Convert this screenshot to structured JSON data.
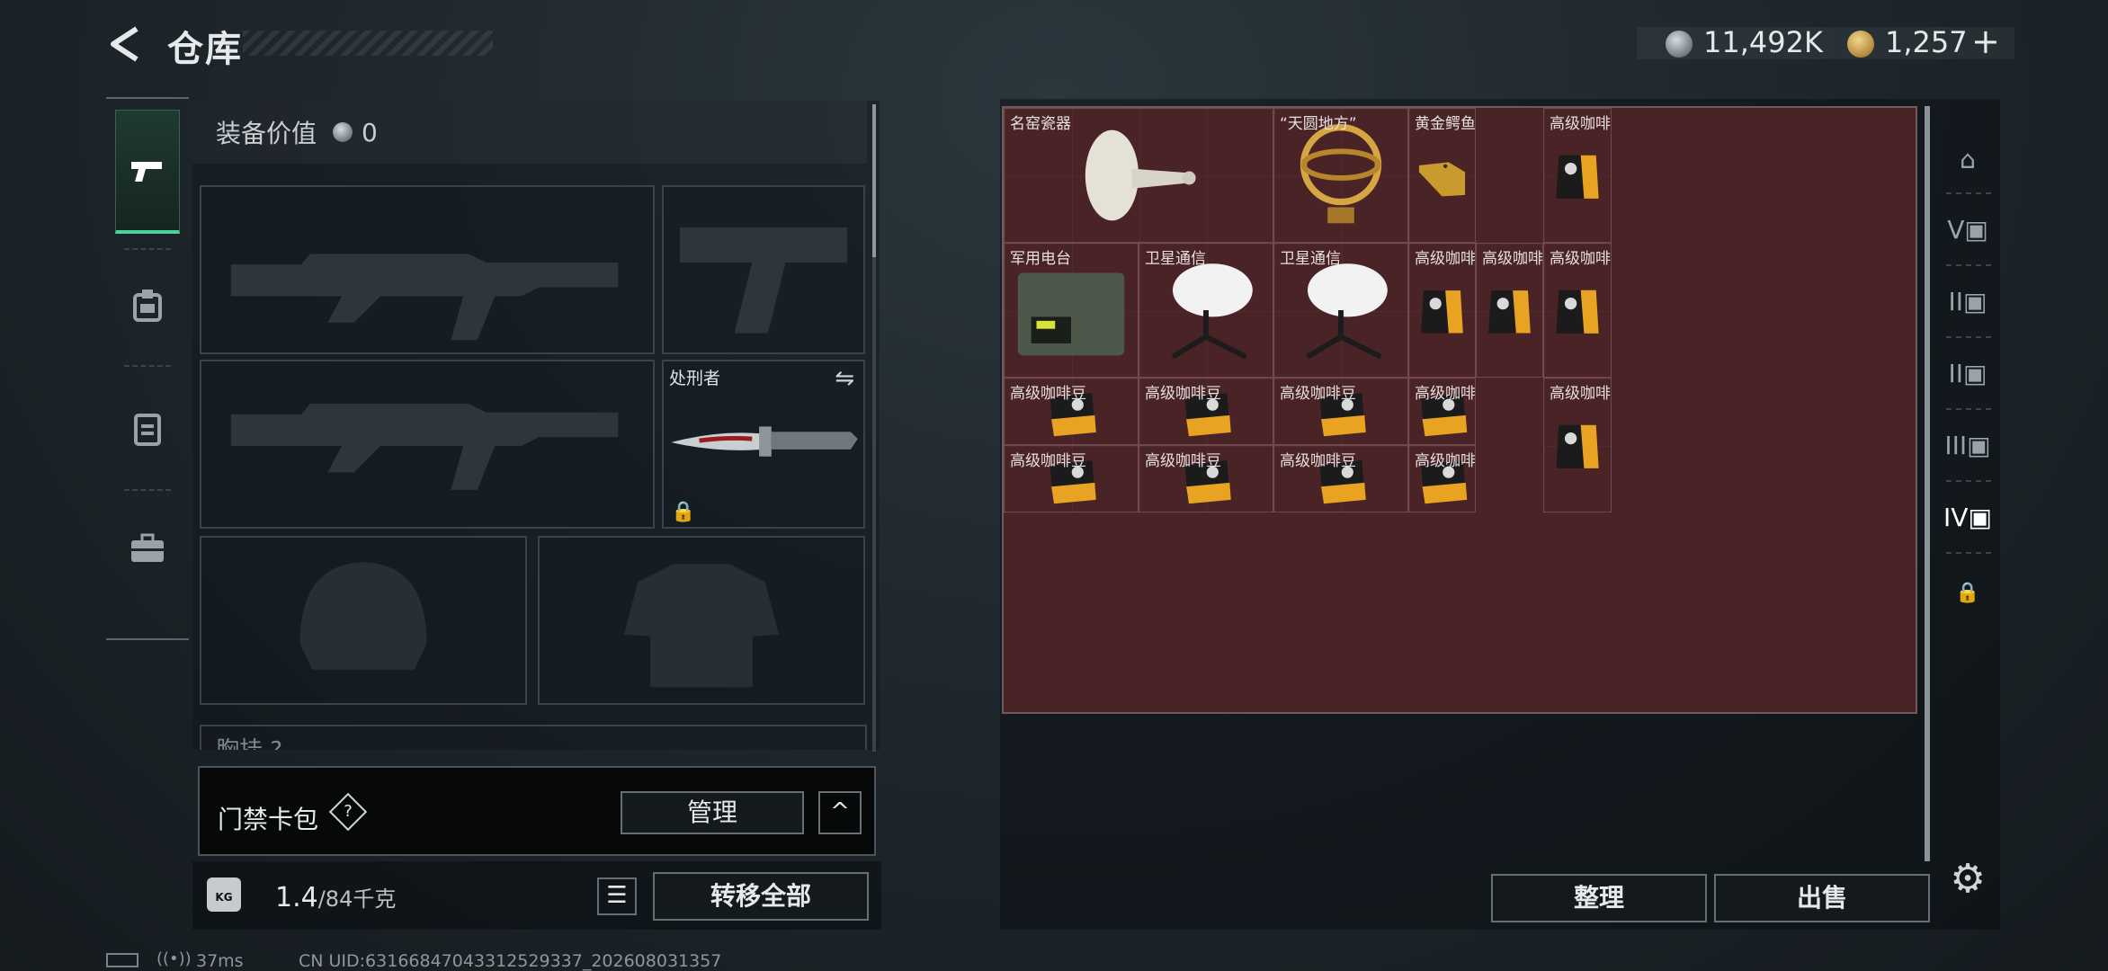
{
  "header": {
    "title": "仓库",
    "currency_silver": "11,492K",
    "currency_gold": "1,257",
    "currency_add": "+"
  },
  "tabs": [
    {
      "icon": "pistol-icon",
      "active": true
    },
    {
      "icon": "armor-rig-icon",
      "active": false
    },
    {
      "icon": "backpack-icon",
      "active": false
    },
    {
      "icon": "toolbox-icon",
      "active": false
    }
  ],
  "equipment": {
    "value_label": "装备价值",
    "value": "0",
    "knife_name": "处刑者",
    "chest_label": "胸挂 ?"
  },
  "card_wallet": {
    "label": "门禁卡包",
    "help": "?",
    "manage": "管理",
    "collapse": "^"
  },
  "weight": {
    "current": "1.4",
    "max": "/84千克",
    "kg_icon": "KG",
    "transfer_all": "转移全部"
  },
  "stash": {
    "items": [
      {
        "name": "名窑瓷器",
        "kind": "vase"
      },
      {
        "name": "“天圆地方”",
        "kind": "armillary"
      },
      {
        "name": "黄金鳄鱼头",
        "kind": "croc"
      },
      {
        "name": "高级咖啡豆",
        "kind": "bag"
      },
      {
        "name": "军用电台",
        "kind": "radio"
      },
      {
        "name": "卫星通信",
        "kind": "dish"
      },
      {
        "name": "卫星通信",
        "kind": "dish"
      },
      {
        "name": "高级咖啡豆",
        "kind": "bag"
      },
      {
        "name": "高级咖啡豆",
        "kind": "bag"
      },
      {
        "name": "高级咖啡豆",
        "kind": "bag"
      },
      {
        "name": "高级咖啡豆",
        "kind": "box"
      },
      {
        "name": "高级咖啡豆",
        "kind": "box"
      },
      {
        "name": "高级咖啡豆",
        "kind": "box"
      },
      {
        "name": "高级咖啡豆",
        "kind": "box"
      },
      {
        "name": "高级咖啡豆",
        "kind": "bag"
      },
      {
        "name": "高级咖啡豆",
        "kind": "box"
      },
      {
        "name": "高级咖啡豆",
        "kind": "box"
      },
      {
        "name": "高级咖啡豆",
        "kind": "box"
      },
      {
        "name": "高级咖啡豆",
        "kind": "box"
      }
    ],
    "sort_button": "整理",
    "sell_button": "出售"
  },
  "right_tabs": [
    {
      "icon": "safe-box-icon"
    },
    {
      "label": "V",
      "icon": "stash-page-icon"
    },
    {
      "label": "II",
      "icon": "stash-page-icon"
    },
    {
      "label": "II",
      "icon": "stash-page-icon"
    },
    {
      "label": "III",
      "icon": "stash-page-icon"
    },
    {
      "label": "IV",
      "icon": "stash-page-icon",
      "active": true
    },
    {
      "icon": "lock-icon"
    }
  ],
  "status": {
    "ping": "37ms",
    "uid": "CN UID:63166847043312529337_202608031357"
  },
  "colors": {
    "accent_green": "#4ad09a",
    "stash_bg": "#4a2327"
  }
}
